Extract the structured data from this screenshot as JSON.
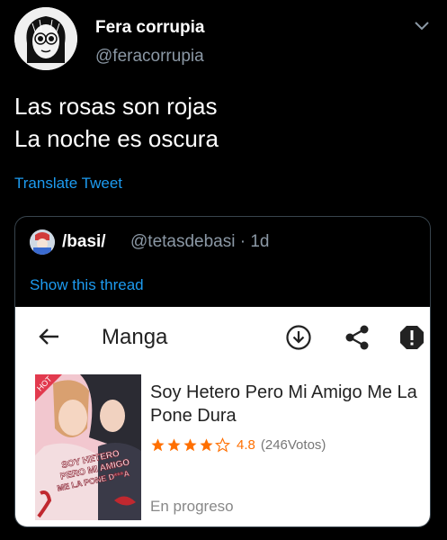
{
  "tweet": {
    "display_name": "Fera corrupia",
    "handle": "@feracorrupia",
    "lines": [
      "Las rosas son rojas",
      "La noche es oscura"
    ],
    "translate_label": "Translate Tweet"
  },
  "quote": {
    "display_name": "/basi/",
    "handle": "@tetasdebasi · 1d",
    "show_thread_label": "Show this thread"
  },
  "screenshot": {
    "title": "Manga",
    "manga_title": "Soy Hetero Pero Mi Amigo Me La Pone Dura",
    "rating": "4.8",
    "rating_fraction": 0.9,
    "votes": "(246Votos)",
    "status": "En progreso",
    "cover_text": [
      "SOY HETERO",
      "PERO MI AMIGO",
      "ME LA PONE D***A"
    ],
    "cover_badge": "HOT",
    "icons": [
      "back-arrow-icon",
      "download-icon",
      "share-icon",
      "report-icon"
    ]
  },
  "colors": {
    "link": "#1d9bf0",
    "muted": "#8b98a5",
    "star": "#ff6f00"
  }
}
